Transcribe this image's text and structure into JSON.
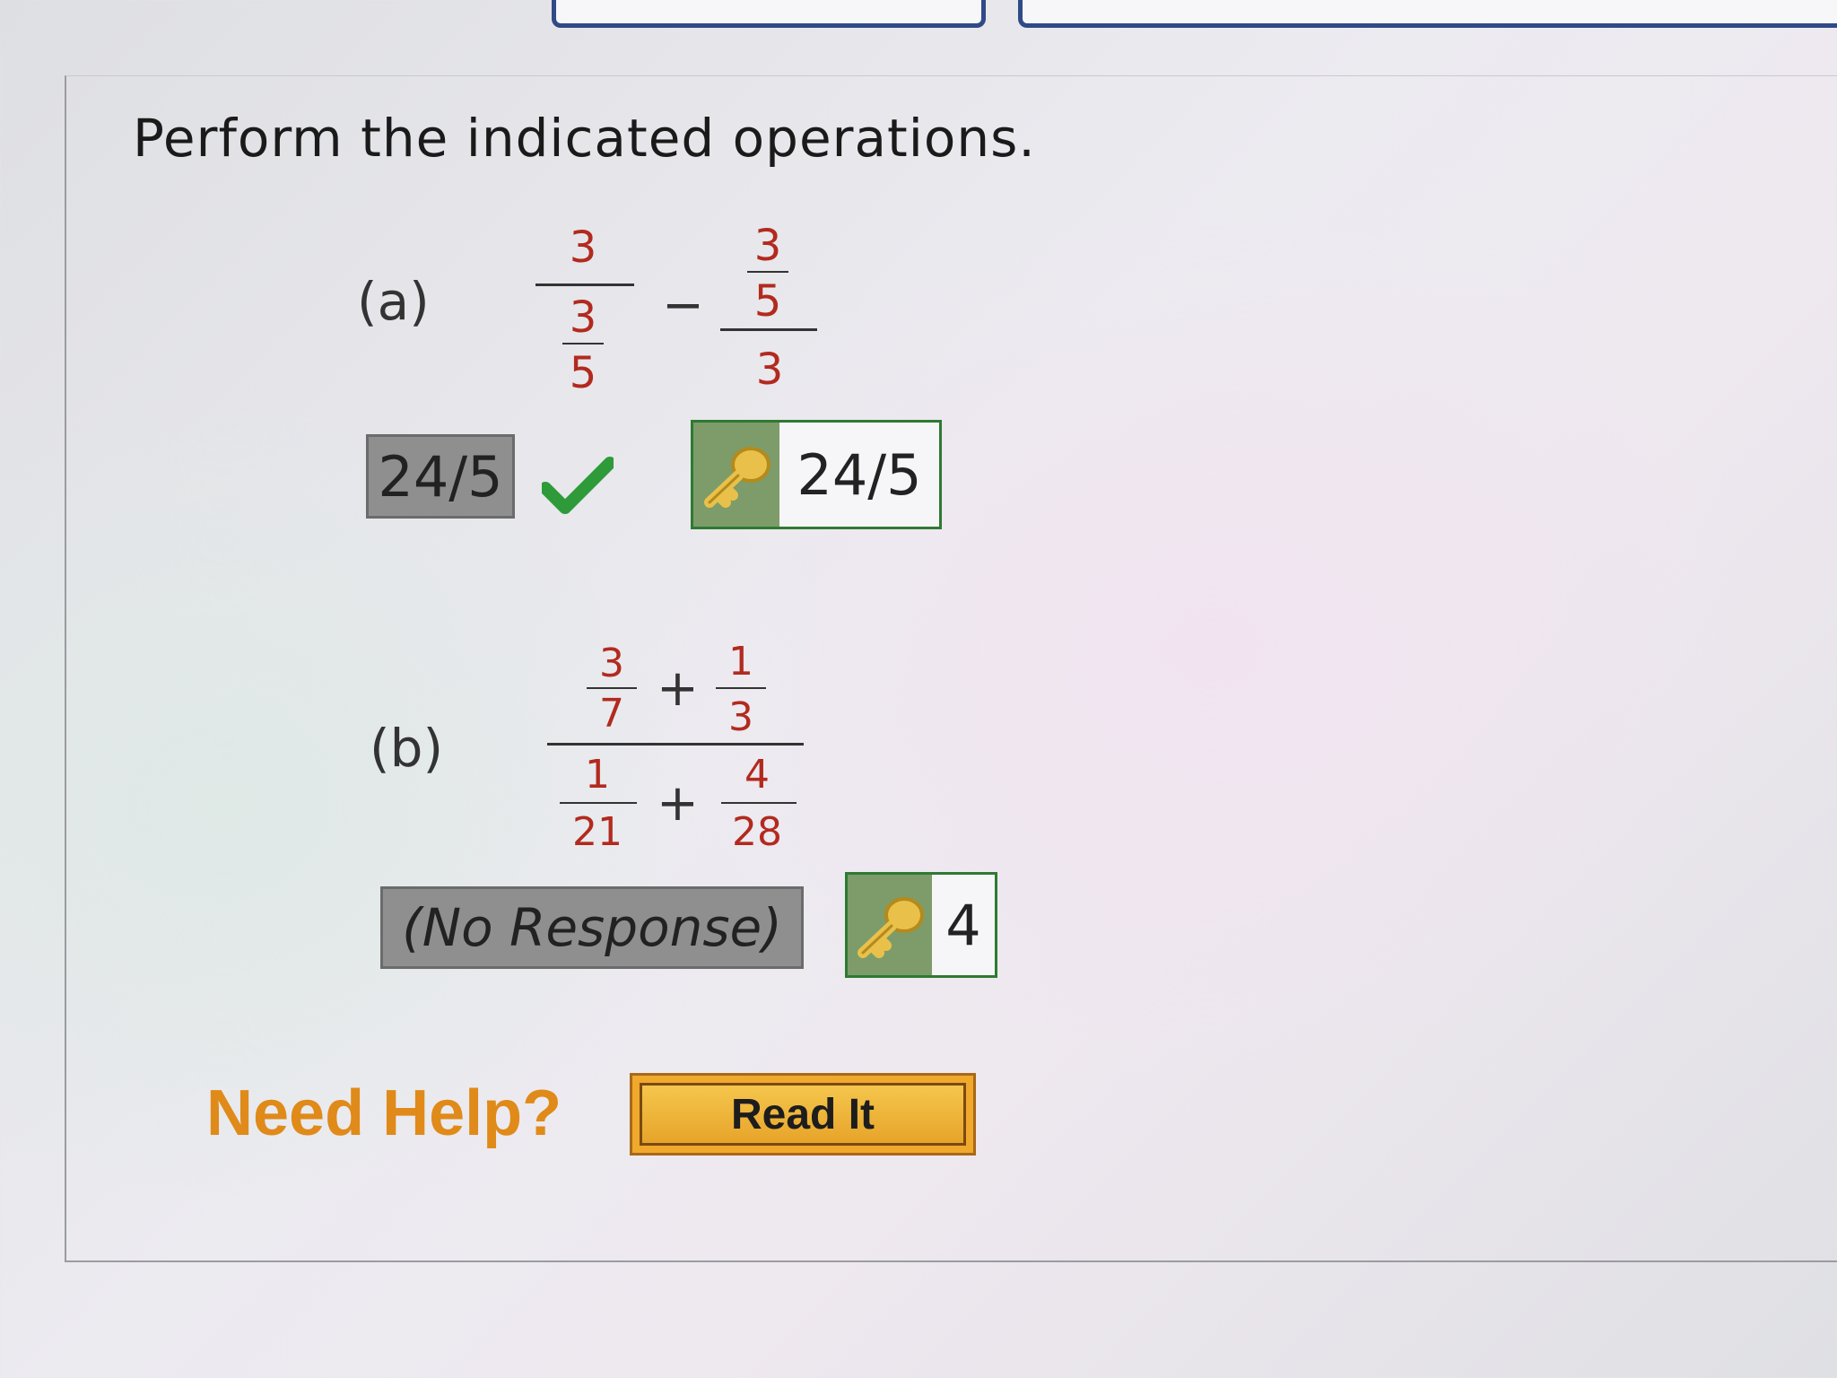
{
  "question": {
    "prompt": "Perform the indicated operations."
  },
  "part_a": {
    "label": "(a)",
    "left_fraction": {
      "numerator": "3",
      "inner_numerator": "3",
      "inner_denominator": "5"
    },
    "operator": "−",
    "right_fraction": {
      "inner_numerator": "3",
      "inner_denominator": "5",
      "denominator": "3"
    },
    "response": "24/5",
    "status": "correct",
    "key_answer": "24/5"
  },
  "part_b": {
    "label": "(b)",
    "top": {
      "a_num": "3",
      "a_den": "7",
      "op": "+",
      "b_num": "1",
      "b_den": "3"
    },
    "bottom": {
      "a_num": "1",
      "a_den": "21",
      "op": "+",
      "b_num": "4",
      "b_den": "28"
    },
    "response": "(No Response)",
    "key_answer": "4"
  },
  "help": {
    "label": "Need Help?",
    "read_button": "Read It"
  },
  "colors": {
    "numeral_red": "#b22a1e",
    "correct_green": "#2e9a3a",
    "key_border": "#2e7a32",
    "help_orange": "#e08a1a",
    "button_gold": "#f0a92c"
  },
  "icons": {
    "check": "checkmark-icon",
    "key": "key-icon"
  }
}
